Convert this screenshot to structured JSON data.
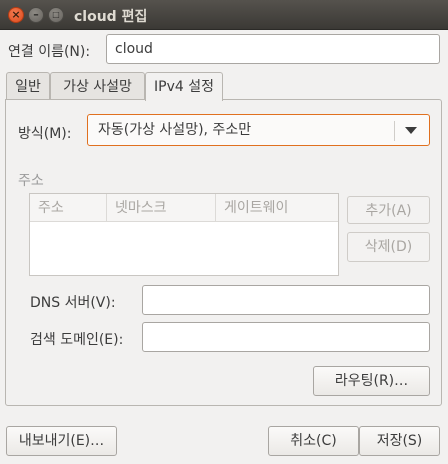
{
  "window": {
    "title": "cloud 편집",
    "close_glyph": "×",
    "minimize_glyph": "–",
    "maximize_glyph": "□"
  },
  "connection_name": {
    "label": "연결 이름(N):",
    "value": "cloud"
  },
  "tabs": [
    {
      "label": "일반",
      "active": false
    },
    {
      "label": "가상 사설망",
      "active": false
    },
    {
      "label": "IPv4 설정",
      "active": true
    }
  ],
  "ipv4": {
    "method_label": "방식(M):",
    "method_value": "자동(가상 사설망), 주소만",
    "addresses_heading": "주소",
    "table_headers": [
      "주소",
      "넷마스크",
      "게이트웨이"
    ],
    "add_button": "추가(A)",
    "delete_button": "삭제(D)",
    "dns_label": "DNS 서버(V):",
    "dns_value": "",
    "search_domains_label": "검색 도메인(E):",
    "search_domains_value": "",
    "routes_button": "라우팅(R)…"
  },
  "footer": {
    "export_button": "내보내기(E)…",
    "cancel_button": "취소(C)",
    "save_button": "저장(S)"
  },
  "colors": {
    "accent": "#e0701f",
    "titlebar": "#3b3935",
    "close": "#dd4b1d"
  }
}
